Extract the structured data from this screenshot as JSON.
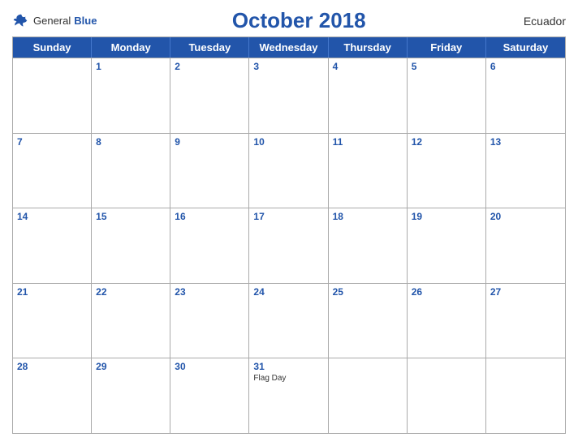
{
  "header": {
    "logo_general": "General",
    "logo_blue": "Blue",
    "month_title": "October 2018",
    "country": "Ecuador"
  },
  "day_headers": [
    "Sunday",
    "Monday",
    "Tuesday",
    "Wednesday",
    "Thursday",
    "Friday",
    "Saturday"
  ],
  "weeks": [
    [
      {
        "number": "",
        "empty": true,
        "events": []
      },
      {
        "number": "1",
        "empty": false,
        "events": []
      },
      {
        "number": "2",
        "empty": false,
        "events": []
      },
      {
        "number": "3",
        "empty": false,
        "events": []
      },
      {
        "number": "4",
        "empty": false,
        "events": []
      },
      {
        "number": "5",
        "empty": false,
        "events": []
      },
      {
        "number": "6",
        "empty": false,
        "events": []
      }
    ],
    [
      {
        "number": "7",
        "empty": false,
        "events": []
      },
      {
        "number": "8",
        "empty": false,
        "events": []
      },
      {
        "number": "9",
        "empty": false,
        "events": []
      },
      {
        "number": "10",
        "empty": false,
        "events": []
      },
      {
        "number": "11",
        "empty": false,
        "events": []
      },
      {
        "number": "12",
        "empty": false,
        "events": []
      },
      {
        "number": "13",
        "empty": false,
        "events": []
      }
    ],
    [
      {
        "number": "14",
        "empty": false,
        "events": []
      },
      {
        "number": "15",
        "empty": false,
        "events": []
      },
      {
        "number": "16",
        "empty": false,
        "events": []
      },
      {
        "number": "17",
        "empty": false,
        "events": []
      },
      {
        "number": "18",
        "empty": false,
        "events": []
      },
      {
        "number": "19",
        "empty": false,
        "events": []
      },
      {
        "number": "20",
        "empty": false,
        "events": []
      }
    ],
    [
      {
        "number": "21",
        "empty": false,
        "events": []
      },
      {
        "number": "22",
        "empty": false,
        "events": []
      },
      {
        "number": "23",
        "empty": false,
        "events": []
      },
      {
        "number": "24",
        "empty": false,
        "events": []
      },
      {
        "number": "25",
        "empty": false,
        "events": []
      },
      {
        "number": "26",
        "empty": false,
        "events": []
      },
      {
        "number": "27",
        "empty": false,
        "events": []
      }
    ],
    [
      {
        "number": "28",
        "empty": false,
        "events": []
      },
      {
        "number": "29",
        "empty": false,
        "events": []
      },
      {
        "number": "30",
        "empty": false,
        "events": []
      },
      {
        "number": "31",
        "empty": false,
        "events": [
          "Flag Day"
        ]
      },
      {
        "number": "",
        "empty": true,
        "events": []
      },
      {
        "number": "",
        "empty": true,
        "events": []
      },
      {
        "number": "",
        "empty": true,
        "events": []
      }
    ]
  ]
}
